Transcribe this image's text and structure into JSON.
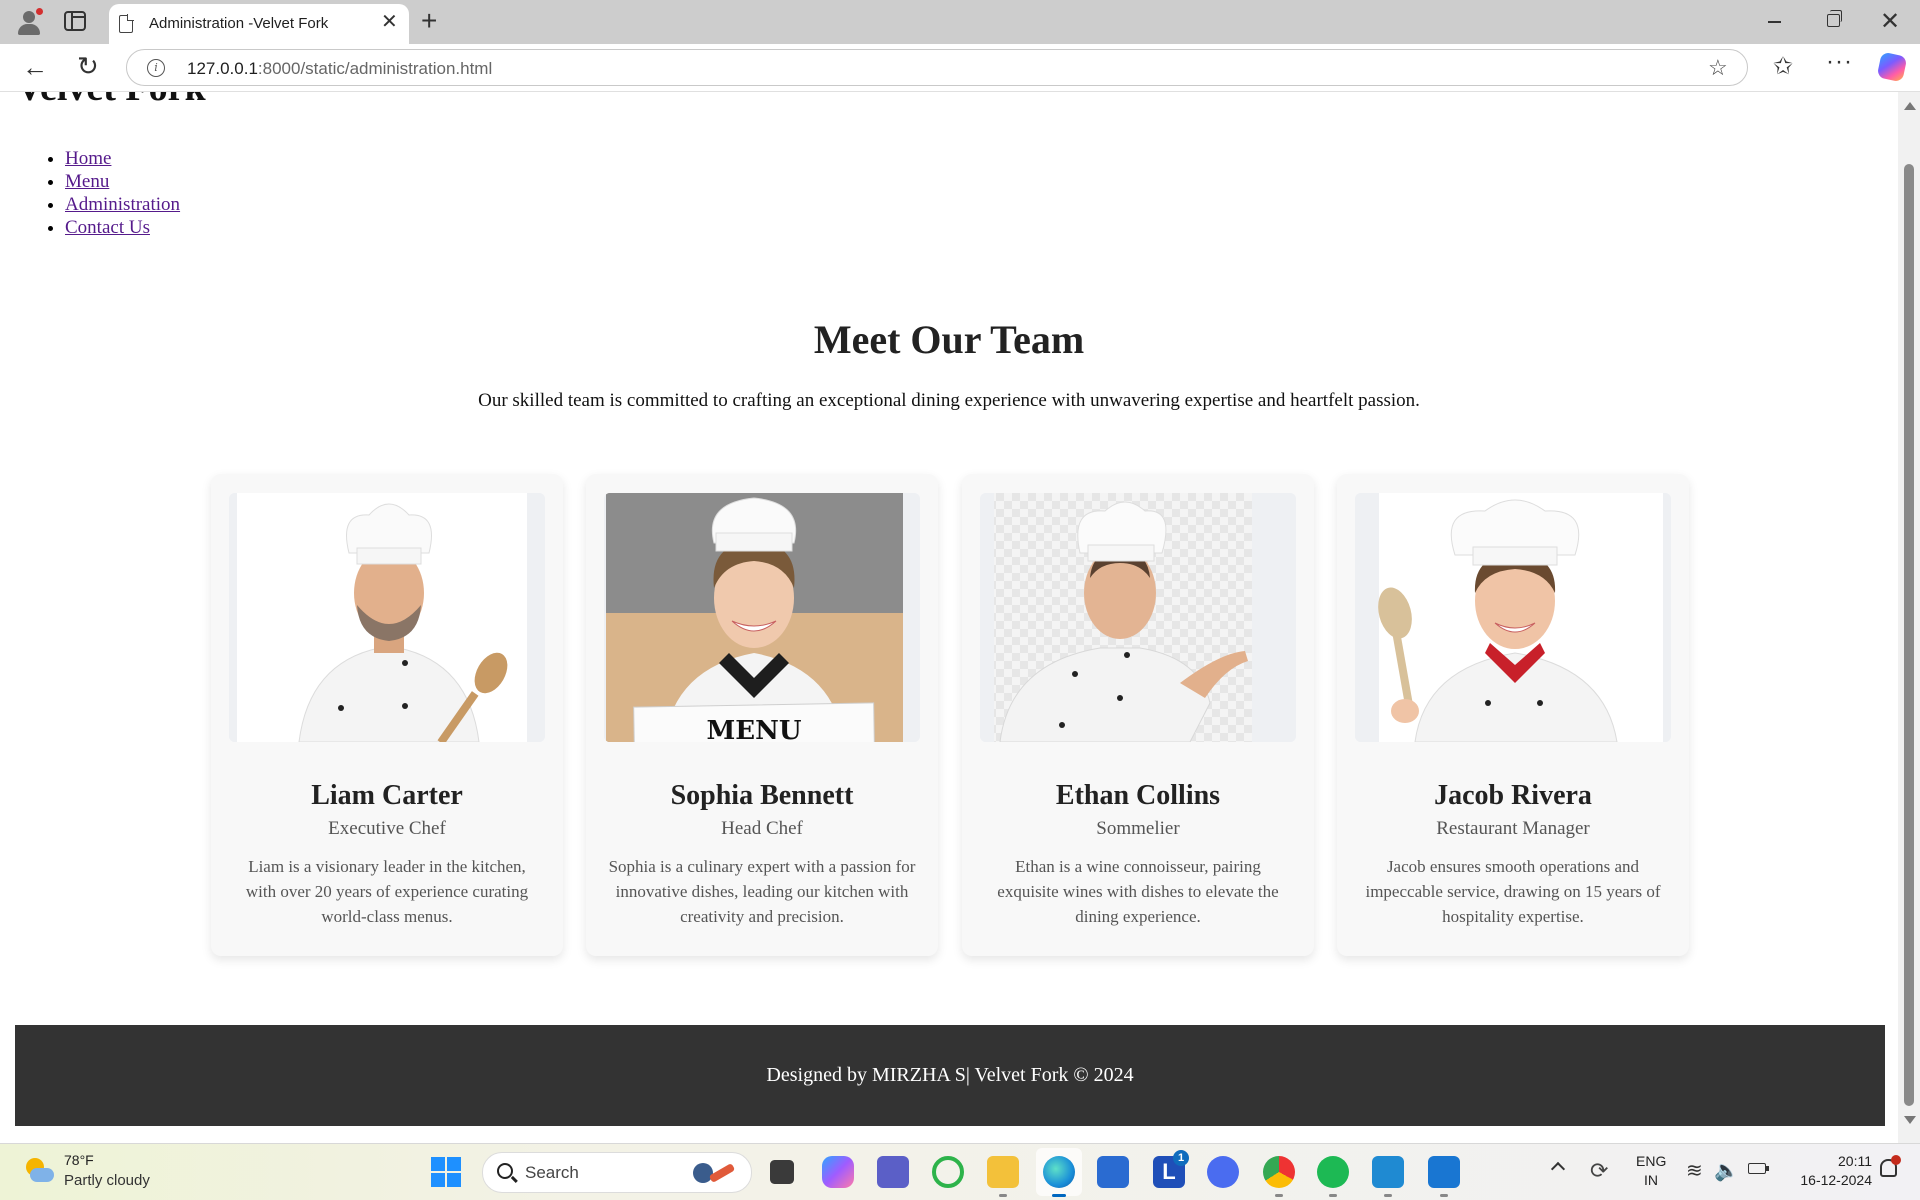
{
  "browser": {
    "tab_title": "Administration -Velvet Fork",
    "url_host": "127.0.0.1",
    "url_rest": ":8000/static/administration.html"
  },
  "page": {
    "site_title": "Velvet Fork",
    "nav": [
      {
        "label": "Home"
      },
      {
        "label": "Menu"
      },
      {
        "label": "Administration"
      },
      {
        "label": "Contact Us"
      }
    ],
    "section_title": "Meet Our Team",
    "section_intro": "Our skilled team is committed to crafting an exceptional dining experience with unwavering expertise and heartfelt passion.",
    "team": [
      {
        "name": "Liam Carter",
        "role": "Executive Chef",
        "bio": "Liam is a visionary leader in the kitchen, with over 20 years of experience curating world-class menus."
      },
      {
        "name": "Sophia Bennett",
        "role": "Head Chef",
        "bio": "Sophia is a culinary expert with a passion for innovative dishes, leading our kitchen with creativity and precision.",
        "photo_sign": "MENU"
      },
      {
        "name": "Ethan Collins",
        "role": "Sommelier",
        "bio": "Ethan is a wine connoisseur, pairing exquisite wines with dishes to elevate the dining experience."
      },
      {
        "name": "Jacob Rivera",
        "role": "Restaurant Manager",
        "bio": "Jacob ensures smooth operations and impeccable service, drawing on 15 years of hospitality expertise."
      }
    ],
    "footer": "Designed by MIRZHA S| Velvet Fork © 2024"
  },
  "taskbar": {
    "weather_temp": "78°F",
    "weather_desc": "Partly cloudy",
    "search_label": "Search",
    "mail_badge": "1",
    "lang_line1": "ENG",
    "lang_line2": "IN",
    "time": "20:11",
    "date": "16-12-2024"
  },
  "colors": {
    "link": "#551a8b",
    "footer_bg": "#333333",
    "card_bg": "#f8f8f8"
  }
}
